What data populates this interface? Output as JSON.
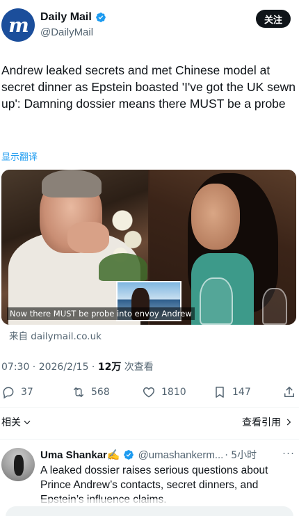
{
  "author": {
    "name": "Daily Mail",
    "handle": "@DailyMail",
    "avatar_text": "m",
    "follow_label": "关注"
  },
  "tweet": {
    "text": "Andrew leaked secrets and met Chinese model at secret dinner as Epstein boasted 'I've got the UK sewn up': Damning dossier means there MUST be a probe",
    "translate_label": "显示翻译",
    "media_caption": "Now there MUST be probe into envoy Andrew",
    "source_label": "来自 dailymail.co.uk",
    "time": "07:30 · 2026/2/15 · ",
    "views_count": "12万",
    "views_label": " 次查看"
  },
  "actions": {
    "replies": "37",
    "retweets": "568",
    "likes": "1810",
    "bookmarks": "147"
  },
  "related": {
    "label": "相关",
    "quotes_label": "查看引用"
  },
  "reply": {
    "name": "Uma Shankar✍️",
    "handle": "@umashankerm...",
    "time": "· 5小时",
    "more": "···",
    "text": "A leaked dossier raises serious questions about Prince Andrew’s contacts, secret dinners, and Epstein’s influence claims."
  },
  "colors": {
    "accent": "#1d9bf0",
    "text": "#0f1419",
    "muted": "#536471",
    "brand": "#1b4e9b"
  }
}
